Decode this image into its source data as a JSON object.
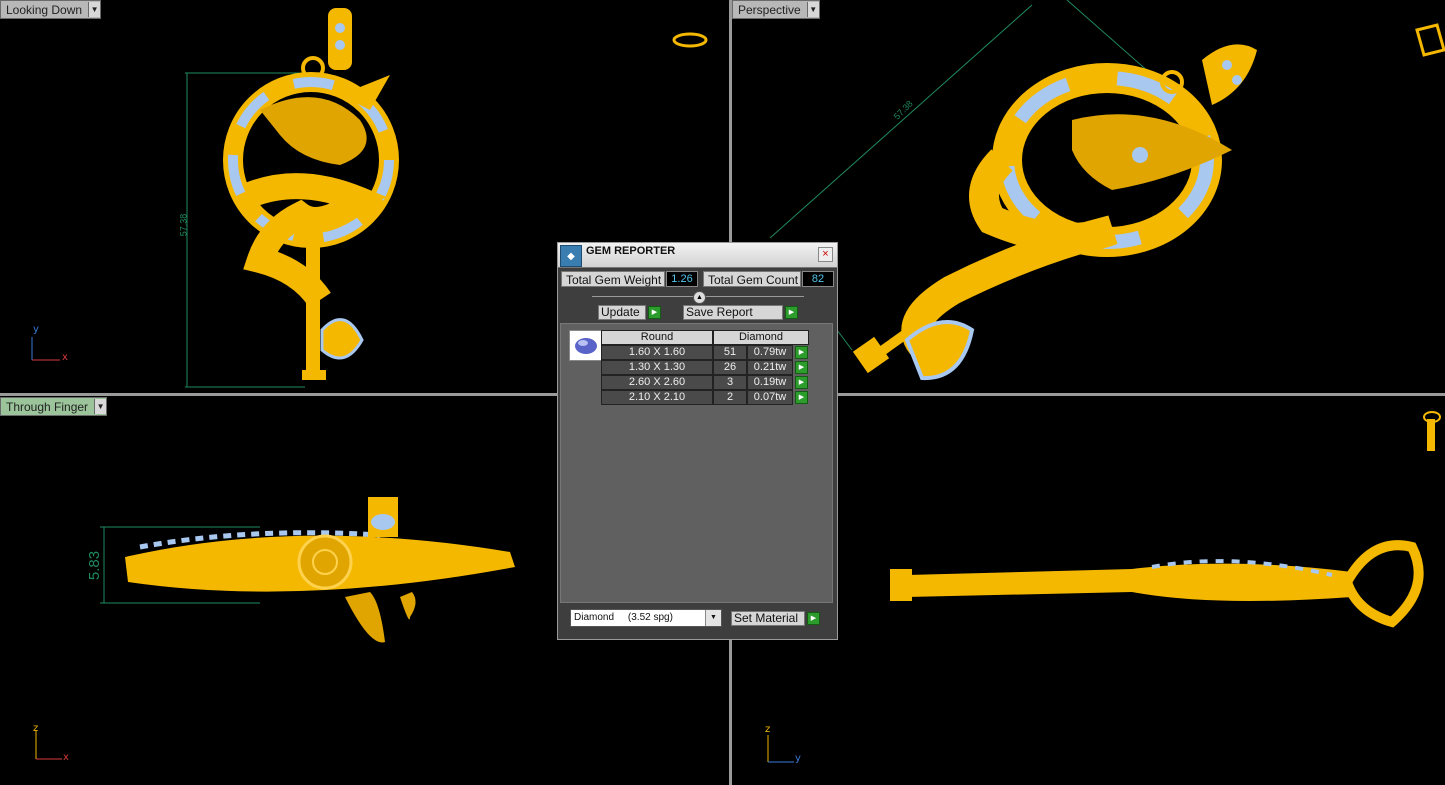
{
  "viewports": {
    "top_left": {
      "label": "Looking Down",
      "dimension": "57.38"
    },
    "top_right": {
      "label": "Perspective",
      "dimension": "57.38"
    },
    "bottom_left": {
      "label": "Through Finger",
      "dimension": "5.83"
    },
    "bottom_right": {
      "label": ""
    }
  },
  "axes": {
    "x": "x",
    "y": "y",
    "z": "z"
  },
  "dialog": {
    "title": "GEM REPORTER",
    "total_gem_weight_label": "Total Gem Weight",
    "total_gem_weight_value": "1.26",
    "total_gem_count_label": "Total Gem Count",
    "total_gem_count_value": "82",
    "update_label": "Update",
    "save_report_label": "Save Report",
    "table": {
      "header_shape": "Round",
      "header_material": "Diamond",
      "rows": [
        {
          "size": "1.60 X 1.60",
          "count": "51",
          "weight": "0.79tw"
        },
        {
          "size": "1.30 X 1.30",
          "count": "26",
          "weight": "0.21tw"
        },
        {
          "size": "2.60 X 2.60",
          "count": "3",
          "weight": "0.19tw"
        },
        {
          "size": "2.10 X 2.10",
          "count": "2",
          "weight": "0.07tw"
        }
      ]
    },
    "material_select": "Diamond     (3.52 spg)",
    "set_material_label": "Set Material"
  },
  "colors": {
    "gold": "#f5b800",
    "gem": "#a8c8f0",
    "dimension": "#1f8a5e",
    "viewport_bg": "#000000"
  }
}
